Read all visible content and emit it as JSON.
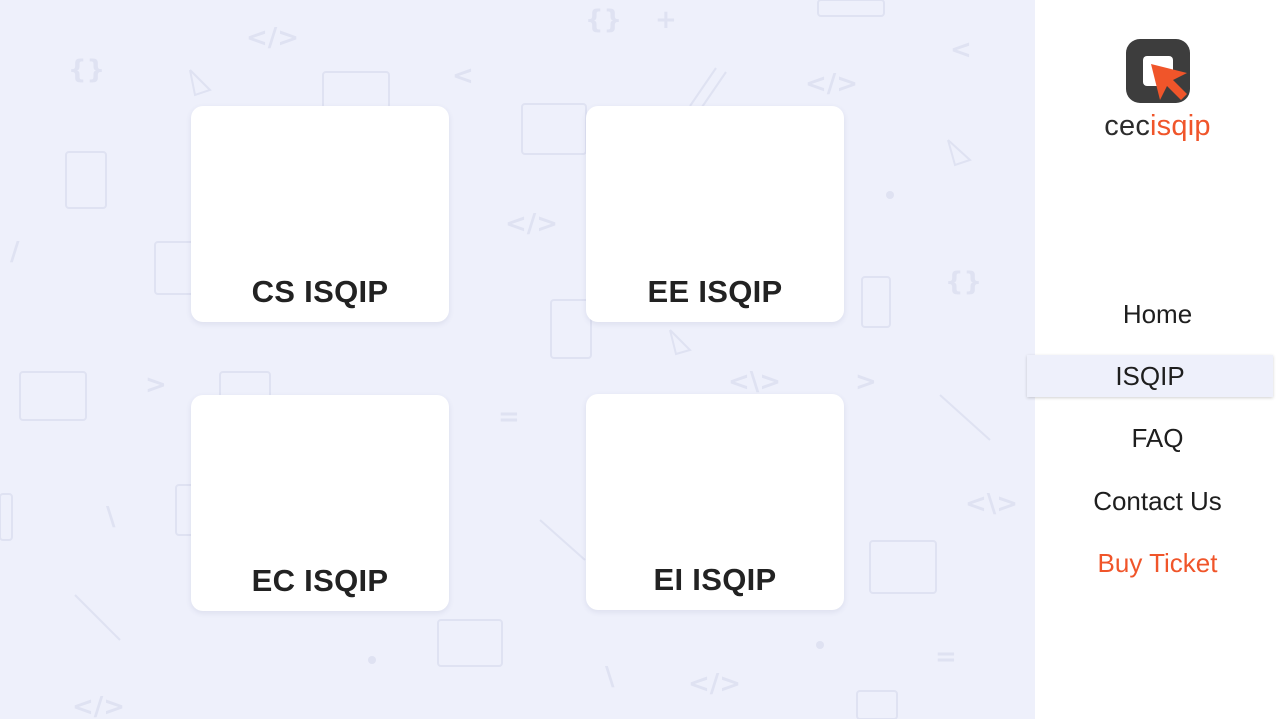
{
  "brand": {
    "name_part1": "cec",
    "name_part2": "isqip",
    "dark_color": "#3d3d3d",
    "accent_color": "#f0552a"
  },
  "cards": [
    {
      "label": "CS ISQIP"
    },
    {
      "label": "EE ISQIP"
    },
    {
      "label": "EC ISQIP"
    },
    {
      "label": "EI ISQIP"
    }
  ],
  "nav": {
    "items": [
      {
        "label": "Home"
      },
      {
        "label": "ISQIP",
        "active": true
      },
      {
        "label": "FAQ"
      },
      {
        "label": "Contact Us"
      },
      {
        "label": "Buy Ticket"
      }
    ]
  },
  "colors": {
    "background": "#eef0fb",
    "cta": "#f0552a"
  }
}
